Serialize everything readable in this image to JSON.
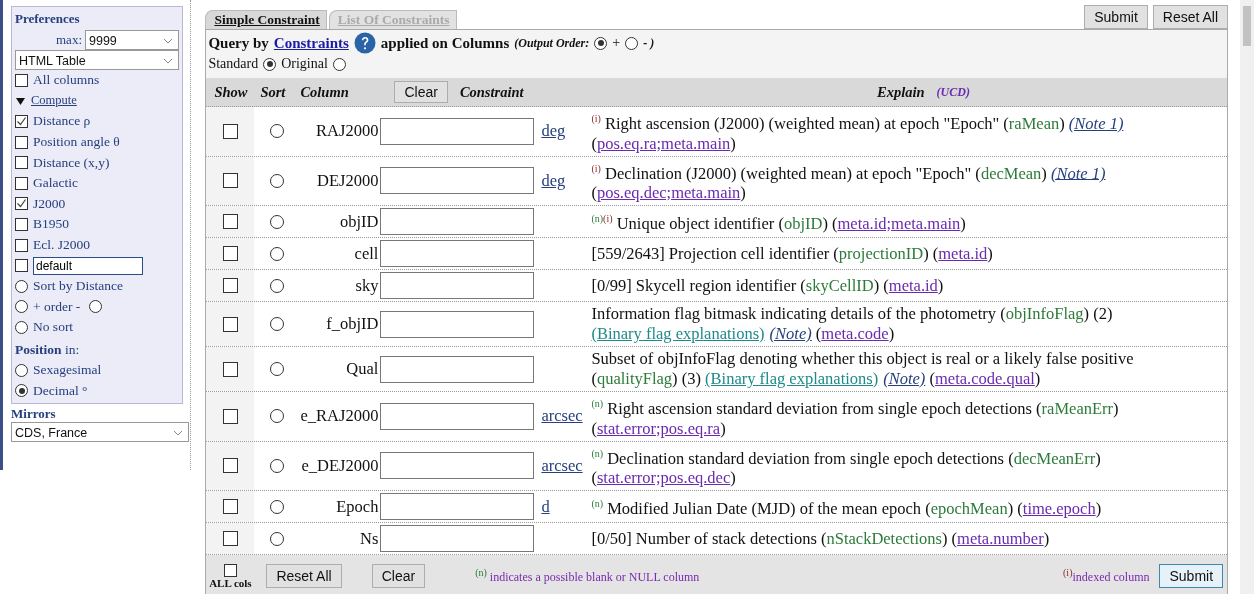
{
  "sidebar": {
    "title": "Preferences",
    "max_label": "max:",
    "max_value": "9999",
    "format_value": "HTML Table",
    "all_columns": {
      "label": "All columns",
      "checked": false
    },
    "compute": {
      "label": "Compute",
      "expanded": true
    },
    "compute_options": [
      {
        "label": "Distance ρ",
        "checked": true
      },
      {
        "label": "Position angle θ",
        "checked": false
      },
      {
        "label": "Distance (x,y)",
        "checked": false
      },
      {
        "label": "Galactic",
        "checked": false
      },
      {
        "label": "J2000",
        "checked": true
      },
      {
        "label": "B1950",
        "checked": false
      },
      {
        "label": "Ecl. J2000",
        "checked": false
      }
    ],
    "custom": {
      "checked": false,
      "value": "default"
    },
    "sort_options": [
      {
        "label": "Sort by Distance",
        "selected": false
      },
      {
        "label": "+ order -",
        "selected": false,
        "minus_selected": false
      },
      {
        "label": "No sort",
        "selected": false
      }
    ],
    "position_label": "**Position** in:",
    "position_options": [
      {
        "label": "Sexagesimal",
        "selected": false
      },
      {
        "label": "Decimal °",
        "selected": true
      }
    ],
    "mirrors_label": "Mirrors",
    "mirror_value": "CDS, France"
  },
  "tabs": [
    {
      "label": "Simple Constraint",
      "selected": true
    },
    {
      "label": "List Of Constraints",
      "selected": false
    }
  ],
  "top_buttons": [
    "Submit",
    "Reset All"
  ],
  "query": {
    "prefix": "Query by",
    "link": "Constraints",
    "middle": "applied on Columns",
    "order_label": "(Output Order:",
    "plus": {
      "label": "+",
      "selected": true
    },
    "minus": {
      "label": "- )",
      "selected": false
    }
  },
  "names": [
    {
      "label": "Standard",
      "selected": true
    },
    {
      "label": "Original",
      "selected": false
    }
  ],
  "header": {
    "show": "Show",
    "sort": "Sort",
    "column": "Column",
    "clear": "Clear",
    "constraint": "Constraint",
    "explain": "Explain",
    "ucd": "(UCD)"
  },
  "rows": [
    {
      "show": false,
      "sort_selected": false,
      "column": "RAJ2000",
      "unit": "deg",
      "desc": [
        {
          "kind": "index_flag",
          "text": "(i)"
        },
        {
          "kind": "text",
          "text": " Right ascension (J2000) (weighted mean) at epoch \"Epoch\" ("
        },
        {
          "kind": "name",
          "text": "raMean"
        },
        {
          "kind": "text",
          "text": ") "
        },
        {
          "kind": "note",
          "text": "(Note 1)"
        },
        {
          "kind": "text",
          "text": " ("
        },
        {
          "kind": "ucd",
          "text": "pos.eq.ra;meta.main"
        },
        {
          "kind": "text",
          "text": ")"
        }
      ]
    },
    {
      "show": false,
      "sort_selected": false,
      "column": "DEJ2000",
      "unit": "deg",
      "desc": [
        {
          "kind": "index_flag",
          "text": "(i)"
        },
        {
          "kind": "text",
          "text": " Declination (J2000) (weighted mean) at epoch \"Epoch\" ("
        },
        {
          "kind": "name",
          "text": "decMean"
        },
        {
          "kind": "text",
          "text": ") "
        },
        {
          "kind": "note",
          "text": "(Note 1)"
        },
        {
          "kind": "text",
          "text": " ("
        },
        {
          "kind": "ucd",
          "text": "pos.eq.dec;meta.main"
        },
        {
          "kind": "text",
          "text": ")"
        }
      ]
    },
    {
      "show": false,
      "sort_selected": false,
      "column": "objID",
      "desc": [
        {
          "kind": "null_flag",
          "text": "(n)"
        },
        {
          "kind": "index_flag",
          "text": "(i)"
        },
        {
          "kind": "text",
          "text": " Unique object identifier ("
        },
        {
          "kind": "name",
          "text": "objID"
        },
        {
          "kind": "text",
          "text": ") ("
        },
        {
          "kind": "ucd",
          "text": "meta.id;meta.main"
        },
        {
          "kind": "text",
          "text": ")"
        }
      ]
    },
    {
      "show": false,
      "sort_selected": false,
      "column": "cell",
      "desc": [
        {
          "kind": "text",
          "text": "[559/2643] Projection cell identifier ("
        },
        {
          "kind": "name",
          "text": "projectionID"
        },
        {
          "kind": "text",
          "text": ") ("
        },
        {
          "kind": "ucd",
          "text": "meta.id"
        },
        {
          "kind": "text",
          "text": ")"
        }
      ]
    },
    {
      "show": false,
      "sort_selected": false,
      "column": "sky",
      "desc": [
        {
          "kind": "text",
          "text": "[0/99] Skycell region identifier ("
        },
        {
          "kind": "name",
          "text": "skyCellID"
        },
        {
          "kind": "text",
          "text": ") ("
        },
        {
          "kind": "ucd",
          "text": "meta.id"
        },
        {
          "kind": "text",
          "text": ")"
        }
      ]
    },
    {
      "show": false,
      "sort_selected": false,
      "column": "f_objID",
      "desc": [
        {
          "kind": "text",
          "text": "Information flag bitmask indicating details of the photometry ("
        },
        {
          "kind": "name",
          "text": "objInfoFlag"
        },
        {
          "kind": "text",
          "text": ") (2) "
        },
        {
          "kind": "doc",
          "text": "(Binary flag explanations)"
        },
        {
          "kind": "note",
          "text": "(Note)"
        },
        {
          "kind": "text",
          "text": "   ("
        },
        {
          "kind": "ucd",
          "text": "meta.code"
        },
        {
          "kind": "text",
          "text": ")"
        }
      ]
    },
    {
      "show": false,
      "sort_selected": false,
      "column": "Qual",
      "desc": [
        {
          "kind": "text",
          "text": "Subset of objInfoFlag denoting whether this object is real or a likely false positive ("
        },
        {
          "kind": "name",
          "text": "qualityFlag"
        },
        {
          "kind": "text",
          "text": ") (3) "
        },
        {
          "kind": "doc",
          "text": "(Binary flag explanations)"
        },
        {
          "kind": "note",
          "text": "(Note)"
        },
        {
          "kind": "text",
          "text": "   ("
        },
        {
          "kind": "ucd",
          "text": "meta.code.qual"
        },
        {
          "kind": "text",
          "text": ")"
        }
      ]
    },
    {
      "show": false,
      "sort_selected": false,
      "column": "e_RAJ2000",
      "unit": "arcsec",
      "desc": [
        {
          "kind": "null_flag",
          "text": "(n)"
        },
        {
          "kind": "text",
          "text": " Right ascension standard deviation from single epoch detections ("
        },
        {
          "kind": "name",
          "text": "raMeanErr"
        },
        {
          "kind": "text",
          "text": ") ("
        },
        {
          "kind": "ucd",
          "text": "stat.error;pos.eq.ra"
        },
        {
          "kind": "text",
          "text": ")"
        }
      ]
    },
    {
      "show": false,
      "sort_selected": false,
      "column": "e_DEJ2000",
      "unit": "arcsec",
      "desc": [
        {
          "kind": "null_flag",
          "text": "(n)"
        },
        {
          "kind": "text",
          "text": " Declination standard deviation from single epoch detections ("
        },
        {
          "kind": "name",
          "text": "decMeanErr"
        },
        {
          "kind": "text",
          "text": ") ("
        },
        {
          "kind": "ucd",
          "text": "stat.error;pos.eq.dec"
        },
        {
          "kind": "text",
          "text": ")"
        }
      ]
    },
    {
      "show": false,
      "sort_selected": false,
      "column": "Epoch",
      "unit": "d",
      "desc": [
        {
          "kind": "null_flag",
          "text": "(n)"
        },
        {
          "kind": "text",
          "text": " Modified Julian Date (MJD) of the mean epoch ("
        },
        {
          "kind": "name",
          "text": "epochMean"
        },
        {
          "kind": "text",
          "text": ") ("
        },
        {
          "kind": "ucd",
          "text": "time.epoch"
        },
        {
          "kind": "text",
          "text": ")"
        }
      ]
    },
    {
      "show": false,
      "sort_selected": false,
      "column": "Ns",
      "desc": [
        {
          "kind": "text",
          "text": "[0/50] Number of stack detections ("
        },
        {
          "kind": "name",
          "text": "nStackDetections"
        },
        {
          "kind": "text",
          "text": ") ("
        },
        {
          "kind": "ucd",
          "text": "meta.number"
        },
        {
          "kind": "text",
          "text": ")"
        }
      ]
    }
  ],
  "footer": {
    "all_cols": {
      "label": "ALL cols",
      "checked": false
    },
    "reset": "Reset All",
    "clear": "Clear",
    "null_flag": "(n)",
    "null_note": "indicates a possible blank or NULL column",
    "index_flag": "(i)",
    "index_note": "indexed column",
    "submit": "Submit"
  }
}
